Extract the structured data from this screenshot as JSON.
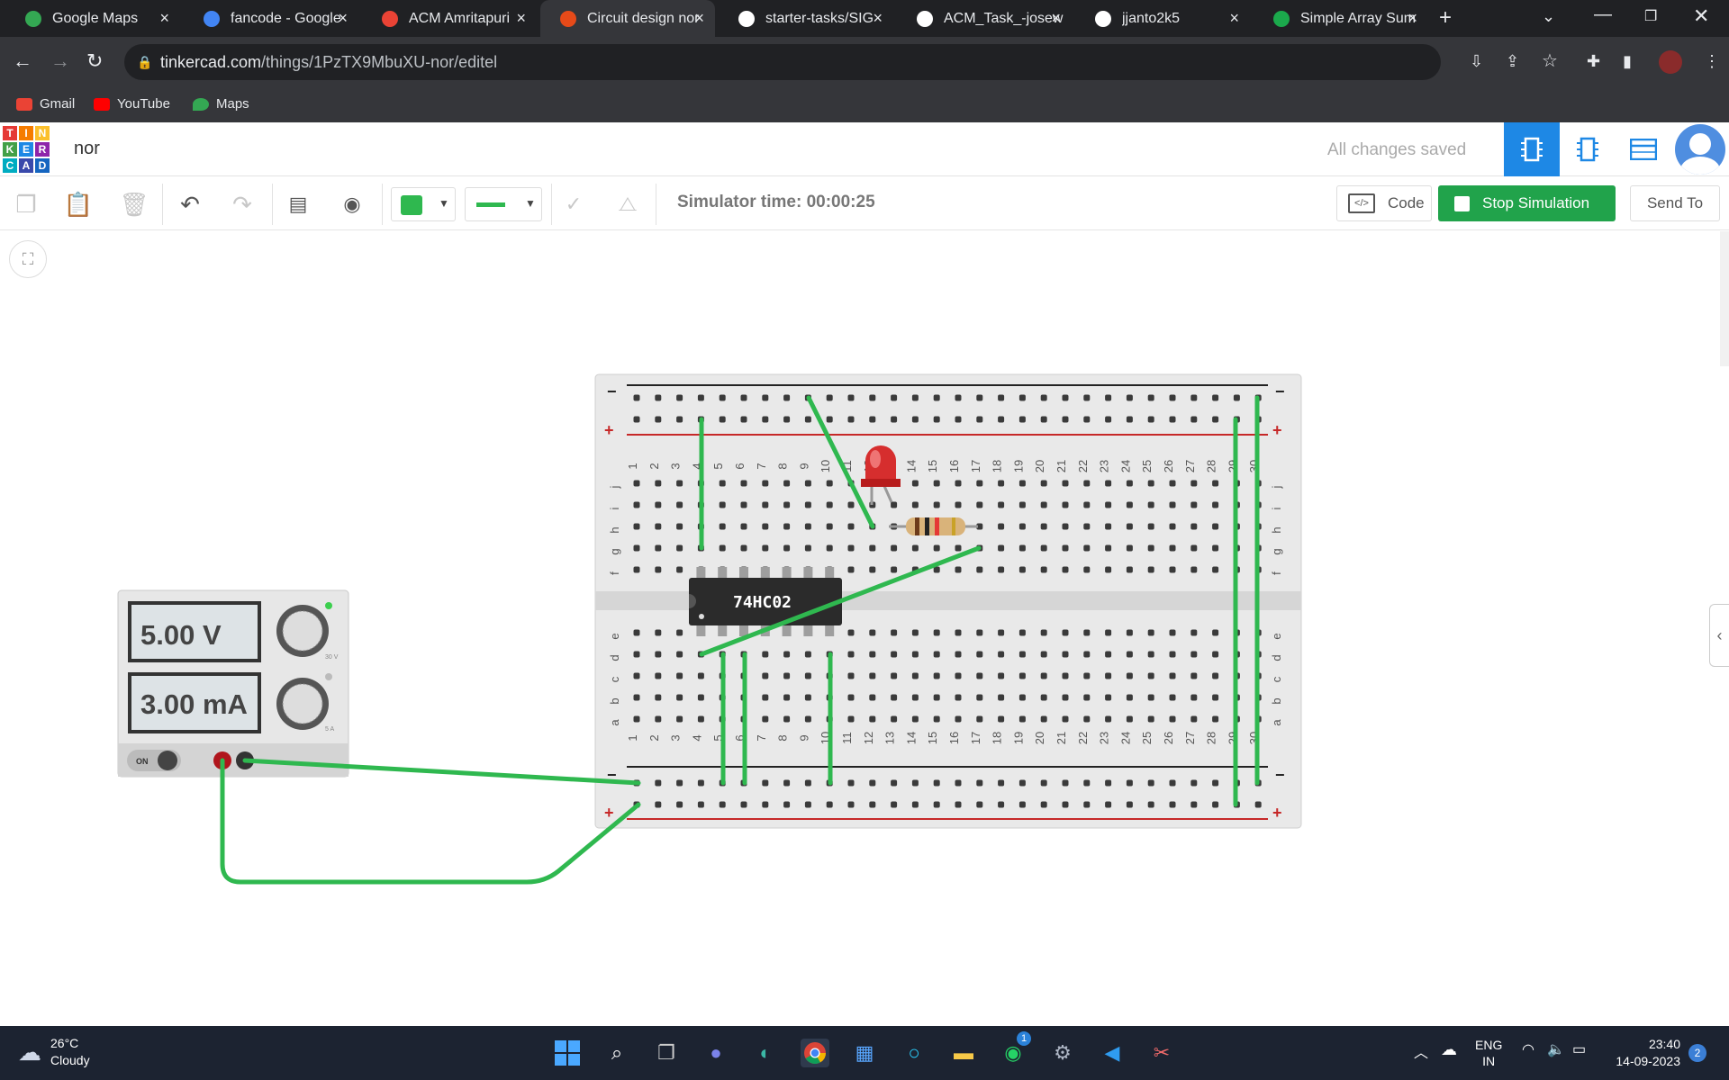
{
  "browser": {
    "tabs": [
      {
        "title": "Google Maps",
        "icon": "maps-pin-icon",
        "color": "#34a853"
      },
      {
        "title": "fancode - Google",
        "icon": "google-icon",
        "color": "#4285f4"
      },
      {
        "title": "ACM Amritapuri",
        "icon": "gmail-icon",
        "color": "#ea4335"
      },
      {
        "title": "Circuit design nor",
        "icon": "tinkercad-icon",
        "color": "#e64a19"
      },
      {
        "title": "starter-tasks/SIG",
        "icon": "github-icon",
        "color": "#ffffff"
      },
      {
        "title": "ACM_Task_-josew",
        "icon": "github-icon",
        "color": "#ffffff"
      },
      {
        "title": "jjanto2k5",
        "icon": "github-icon",
        "color": "#ffffff"
      },
      {
        "title": "Simple Array Sum",
        "icon": "hackerrank-icon",
        "color": "#1ba94c"
      }
    ],
    "url_host": "tinkercad.com",
    "url_path": "/things/1PzTX9MbuXU-nor/editel",
    "bookmarks": [
      "Gmail",
      "YouTube",
      "Maps"
    ]
  },
  "app": {
    "logo_letters": [
      "T",
      "I",
      "N",
      "K",
      "E",
      "R",
      "C",
      "A",
      "D"
    ],
    "logo_colors": [
      "#e53935",
      "#f57c00",
      "#fbc02d",
      "#43a047",
      "#1e88e5",
      "#8e24aa",
      "#00acc1",
      "#3949ab",
      "#1565c0"
    ],
    "project_name": "nor",
    "save_status": "All changes saved"
  },
  "toolbar": {
    "simulator_time": "Simulator time: 00:00:25",
    "wire_color": "#2fb84f",
    "code_label": "Code",
    "stop_label": "Stop Simulation",
    "send_label": "Send To"
  },
  "power_supply": {
    "voltage": "5.00 V",
    "current": "3.00 mA",
    "power_label": "ON",
    "voltage_max": "30 V",
    "current_max": "5 A"
  },
  "breadboard": {
    "chip_label": "74HC02",
    "columns": [
      "1",
      "2",
      "3",
      "4",
      "5",
      "6",
      "7",
      "8",
      "9",
      "10",
      "11",
      "12",
      "13",
      "14",
      "15",
      "16",
      "17",
      "18",
      "19",
      "20",
      "21",
      "22",
      "23",
      "24",
      "25",
      "26",
      "27",
      "28",
      "29",
      "30"
    ],
    "top_rows": [
      "j",
      "i",
      "h",
      "g",
      "f"
    ],
    "bottom_rows": [
      "e",
      "d",
      "c",
      "b",
      "a"
    ]
  },
  "taskbar": {
    "temperature": "26°C",
    "weather": "Cloudy",
    "lang1": "ENG",
    "lang2": "IN",
    "time": "23:40",
    "date": "14-09-2023",
    "notification_count": "2",
    "whatsapp_badge": "1"
  }
}
